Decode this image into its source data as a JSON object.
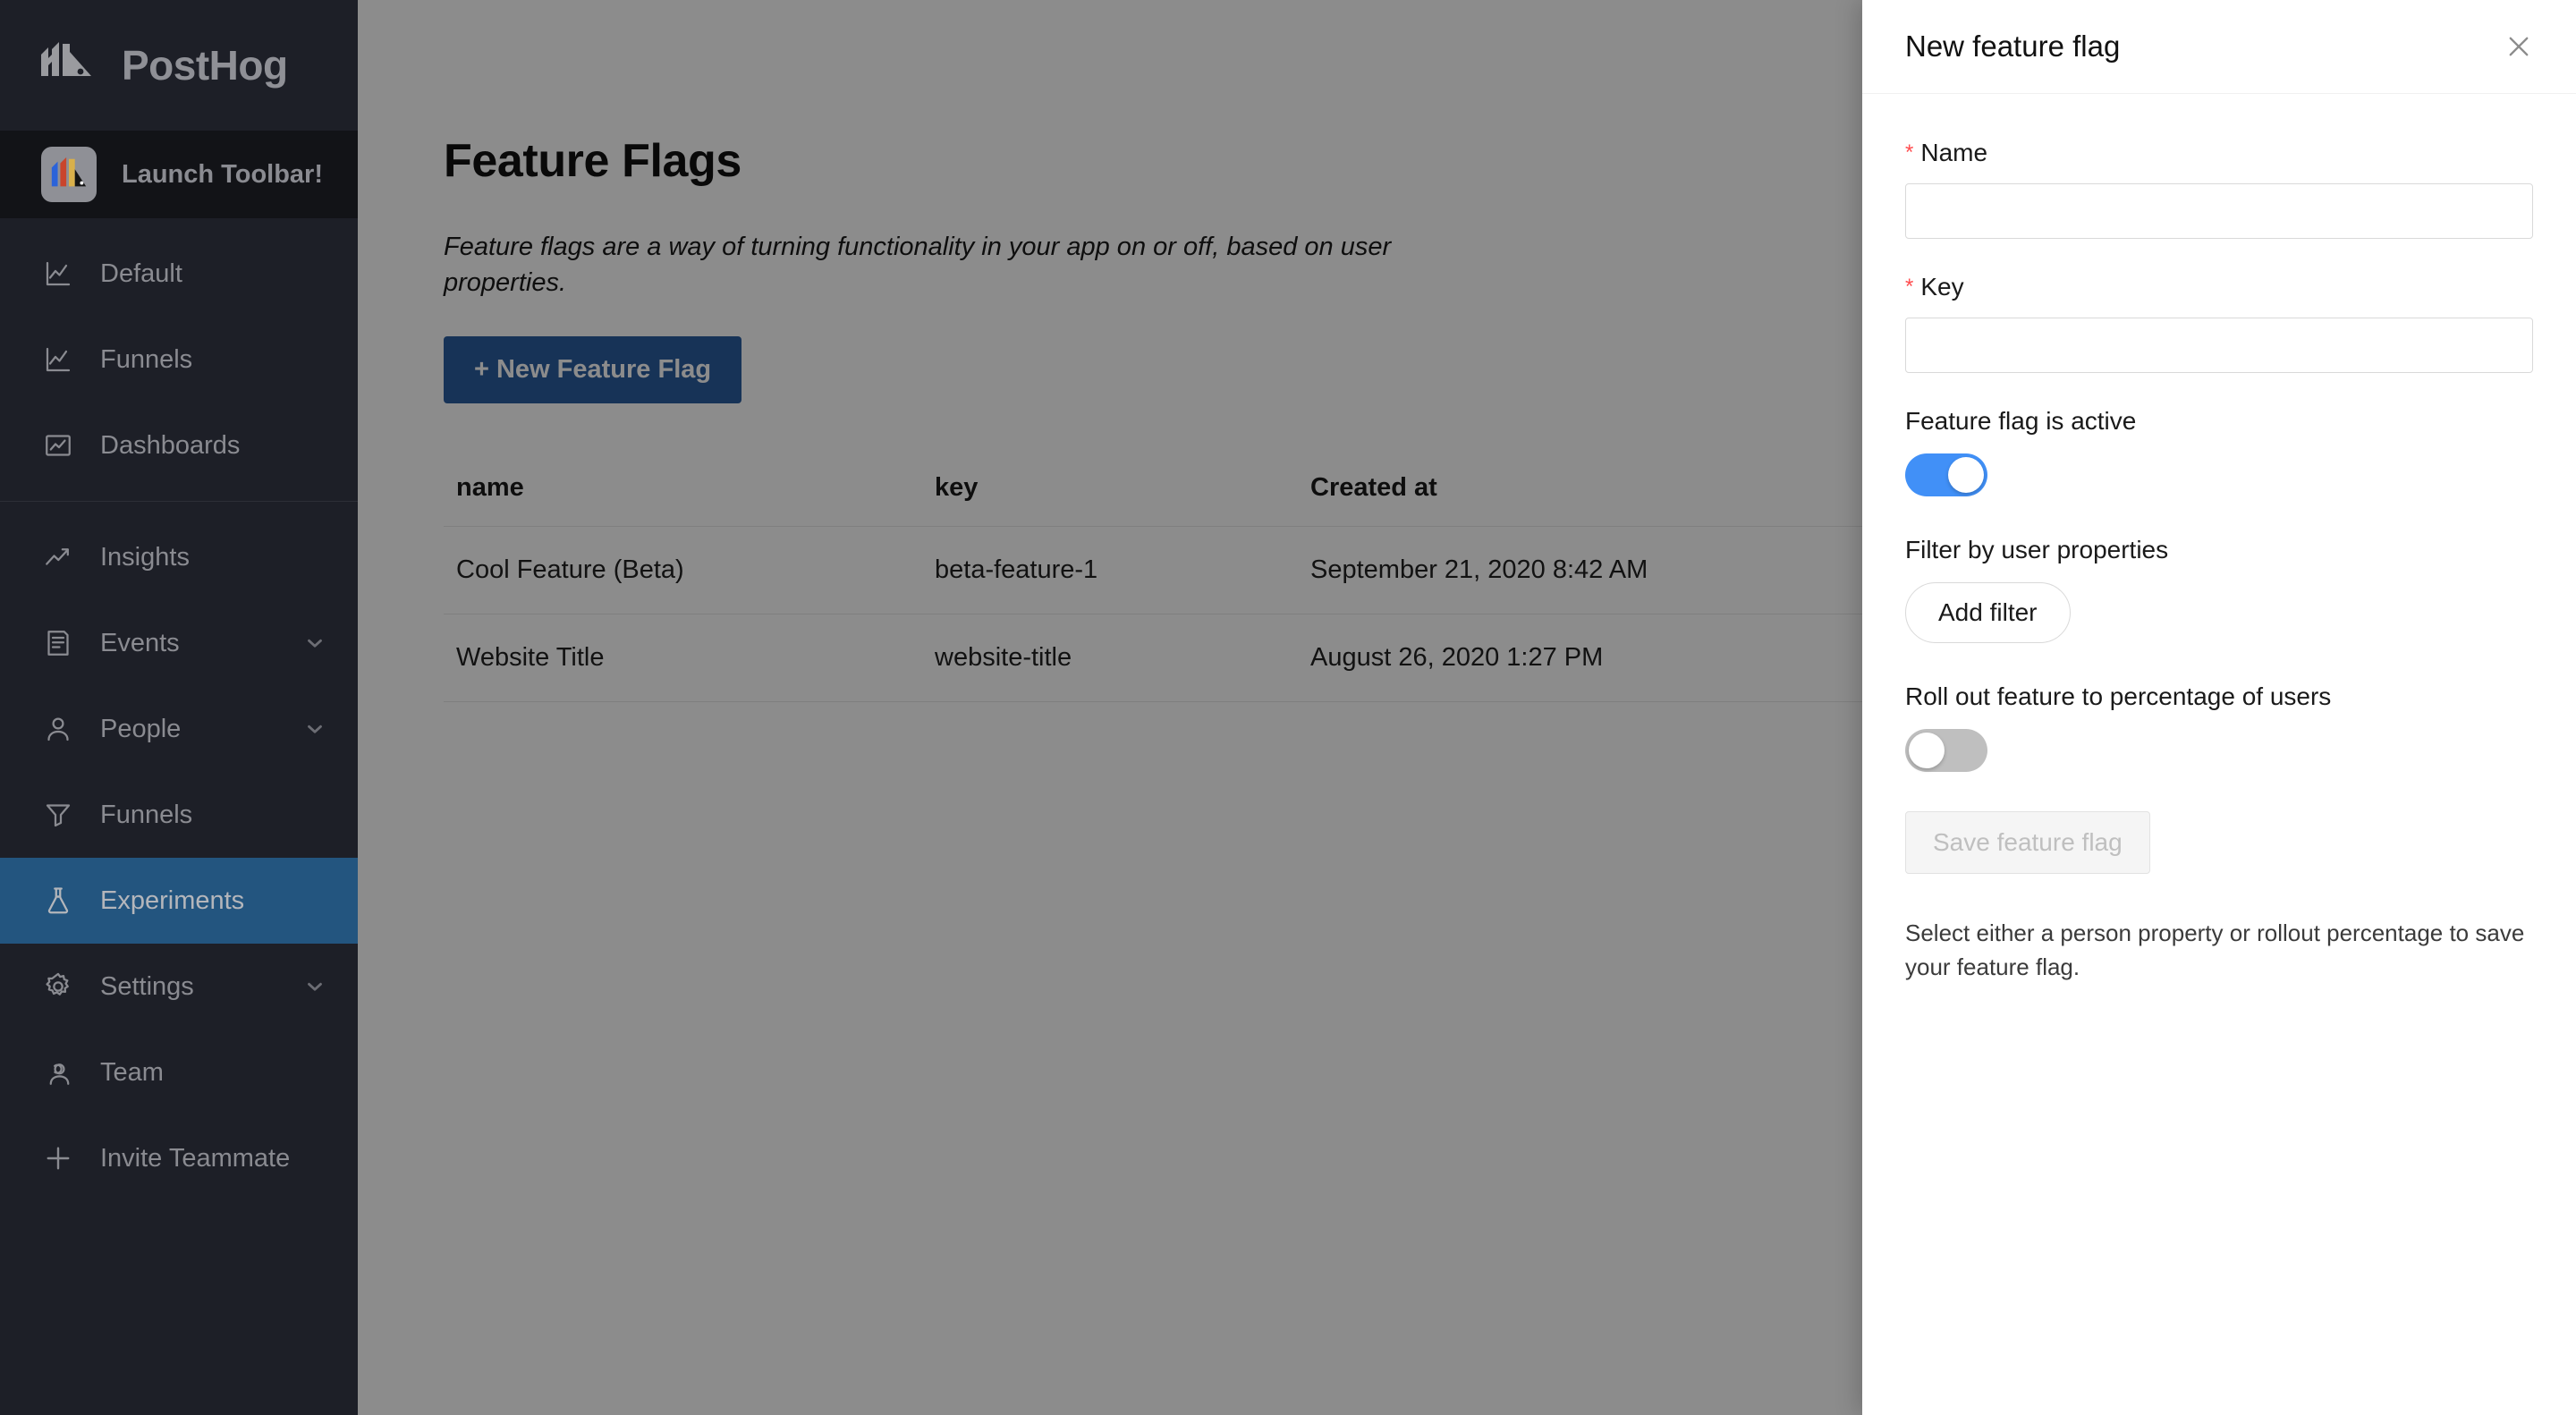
{
  "brand": {
    "name": "PostHog",
    "logo_icon": "posthog-hedgehog-logo"
  },
  "toolbar": {
    "label": "Launch Toolbar!",
    "icon": "posthog-toolbar-icon"
  },
  "sidebar": {
    "groups": [
      {
        "items": [
          {
            "label": "Default",
            "icon": "line-chart-icon",
            "active": false,
            "chevron": false
          },
          {
            "label": "Funnels",
            "icon": "line-chart-icon",
            "active": false,
            "chevron": false
          },
          {
            "label": "Dashboards",
            "icon": "dashboard-icon",
            "active": false,
            "chevron": false
          }
        ]
      },
      {
        "items": [
          {
            "label": "Insights",
            "icon": "trending-up-icon",
            "active": false,
            "chevron": false
          },
          {
            "label": "Events",
            "icon": "events-list-icon",
            "active": false,
            "chevron": true
          },
          {
            "label": "People",
            "icon": "user-icon",
            "active": false,
            "chevron": true
          },
          {
            "label": "Funnels",
            "icon": "funnel-icon",
            "active": false,
            "chevron": false
          },
          {
            "label": "Experiments",
            "icon": "flask-icon",
            "active": true,
            "chevron": false
          },
          {
            "label": "Settings",
            "icon": "gear-icon",
            "active": false,
            "chevron": true
          },
          {
            "label": "Team",
            "icon": "team-icon",
            "active": false,
            "chevron": false
          },
          {
            "label": "Invite Teammate",
            "icon": "plus-icon",
            "active": false,
            "chevron": false
          }
        ]
      }
    ]
  },
  "main": {
    "title": "Feature Flags",
    "description": "Feature flags are a way of turning functionality in your app on or off, based on user properties.",
    "new_flag_button": "+ New Feature Flag",
    "table": {
      "columns": [
        "name",
        "key",
        "Created at"
      ],
      "rows": [
        {
          "name": "Cool Feature (Beta)",
          "key": "beta-feature-1",
          "created_at": "September 21, 2020 8:42 AM"
        },
        {
          "name": "Website Title",
          "key": "website-title",
          "created_at": "August 26, 2020 1:27 PM"
        }
      ]
    }
  },
  "drawer": {
    "title": "New feature flag",
    "close_icon": "close-icon",
    "required_marker": "*",
    "name_field": {
      "label": "Name",
      "value": "",
      "placeholder": ""
    },
    "key_field": {
      "label": "Key",
      "value": "",
      "placeholder": ""
    },
    "active_section": {
      "label": "Feature flag is active",
      "toggle_state": "on"
    },
    "filter_section": {
      "label": "Filter by user properties",
      "add_filter_button": "Add filter"
    },
    "rollout_section": {
      "label": "Roll out feature to percentage of users",
      "toggle_state": "off"
    },
    "save_button": "Save feature flag",
    "help_text": "Select either a person property or rollout percentage to save your feature flag."
  },
  "colors": {
    "sidebar_bg": "#1d1f27",
    "sidebar_active": "#23557f",
    "primary_button": "#2a5d9f",
    "toggle_on": "#4190f7",
    "toggle_off": "#bfbfbf",
    "required_star": "#ff4d4f"
  }
}
